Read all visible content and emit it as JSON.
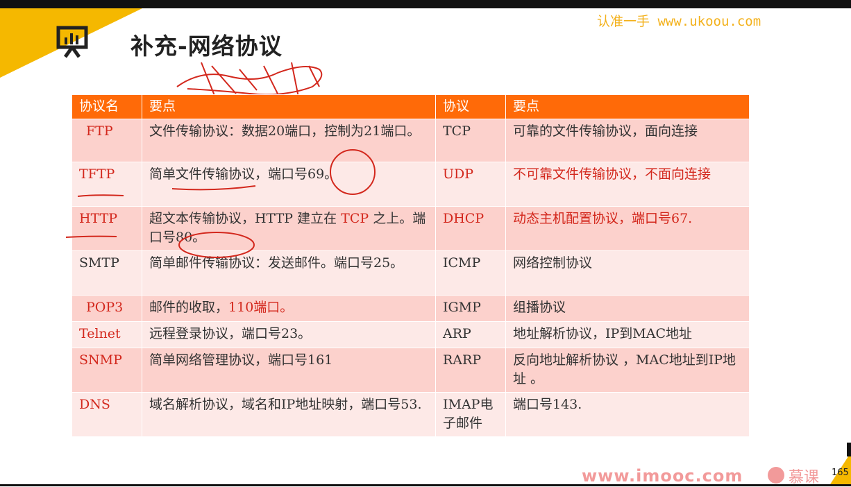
{
  "title": "补充-网络协议",
  "watermark": "认准一手 www.ukoou.com",
  "footer": {
    "site": "www.imooc.com",
    "brand": "慕课",
    "page": "165"
  },
  "table": {
    "headers": [
      "协议名",
      "要点",
      "协议",
      "要点"
    ],
    "rows": [
      {
        "p1": "FTP",
        "d1": "文件传输协议：数据20端口，控制为21端口。",
        "p2": "TCP",
        "d2": "可靠的文件传输协议，面向连接"
      },
      {
        "p1": "TFTP",
        "d1": "简单文件传输协议，端口号69。",
        "p2": "UDP",
        "d2": "不可靠文件传输协议，不面向连接"
      },
      {
        "p1": "HTTP",
        "d1a": "超文本传输协议，HTTP 建立在",
        "d1b": "TCP",
        "d1c": "之上。端口号80。",
        "p2": "DHCP",
        "d2": "动态主机配置协议，端口号67."
      },
      {
        "p1": "SMTP",
        "d1": "简单邮件传输协议：发送邮件。端口号25。",
        "p2": "ICMP",
        "d2": "网络控制协议"
      },
      {
        "p1": "POP3",
        "d1a": "邮件的收取，",
        "d1b": "110端口。",
        "p2": "IGMP",
        "d2": "组播协议"
      },
      {
        "p1": "Telnet",
        "d1": "远程登录协议，端口号23。",
        "p2": "ARP",
        "d2": "地址解析协议，IP到MAC地址"
      },
      {
        "p1": "SNMP",
        "d1": "简单网络管理协议，端口号161",
        "p2": "RARP",
        "d2": "反向地址解析协议 ，MAC地址到IP地址 。"
      },
      {
        "p1": "DNS",
        "d1": "域名解析协议，域名和IP地址映射，端口号53.",
        "p2": "IMAP电子邮件",
        "d2": "端口号143."
      }
    ]
  },
  "colors": {
    "header_bg": "#ff6a08",
    "row_odd": "#fcd1cc",
    "row_even": "#fde9e7",
    "accent_red": "#d3281d",
    "corner_yellow": "#f5b800"
  }
}
